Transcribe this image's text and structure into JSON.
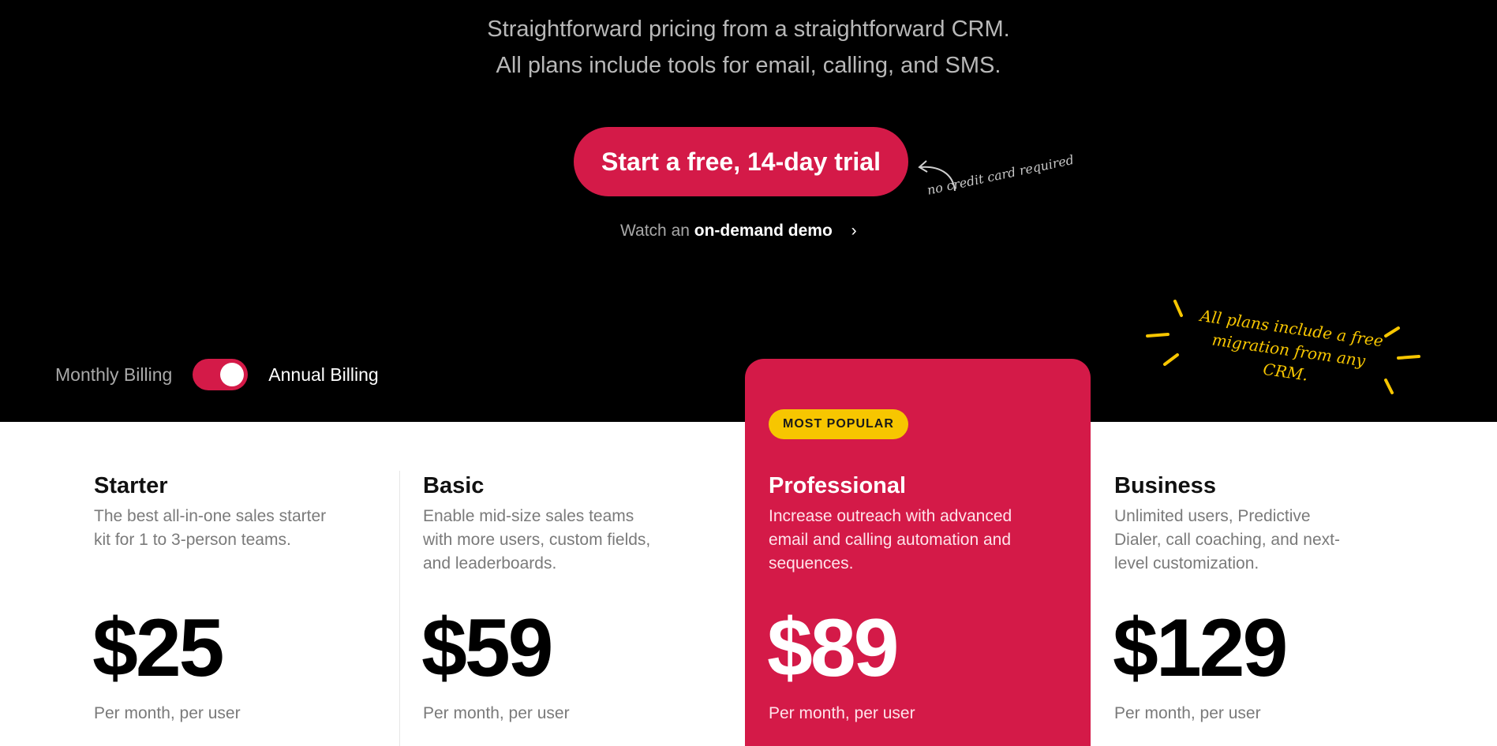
{
  "hero": {
    "subtitle_line1": "Straightforward pricing from a straightforward CRM.",
    "subtitle_line2": "All plans include tools for email, calling, and SMS.",
    "cta_label": "Start a free, 14-day trial",
    "cta_note": "no credit card required",
    "demo_prefix": "Watch an",
    "demo_bold": "on-demand demo",
    "demo_chevron": "›",
    "migration_note": "All plans include a free migration from any CRM."
  },
  "billing": {
    "monthly_label": "Monthly Billing",
    "annual_label": "Annual Billing",
    "annual_selected": true
  },
  "plans": [
    {
      "name": "Starter",
      "description": "The best all-in-one sales starter kit for 1 to 3-person teams.",
      "price": "$25",
      "unit": "Per month, per user"
    },
    {
      "name": "Basic",
      "description": "Enable mid-size sales teams with more users, custom fields, and leaderboards.",
      "price": "$59",
      "unit": "Per month, per user"
    },
    {
      "name": "Professional",
      "badge": "MOST POPULAR",
      "description": "Increase outreach with advanced email and calling automation and sequences.",
      "price": "$89",
      "unit": "Per month, per user"
    },
    {
      "name": "Business",
      "description": "Unlimited users, Predictive Dialer, call coaching, and next-level customization.",
      "price": "$129",
      "unit": "Per month, per user"
    }
  ],
  "colors": {
    "accent": "#d41a48",
    "badge": "#f7c600",
    "hero_bg": "#000000"
  },
  "icons": [
    "chevron-right-icon",
    "curved-arrow-icon",
    "burst-lines-icon",
    "toggle-switch"
  ]
}
